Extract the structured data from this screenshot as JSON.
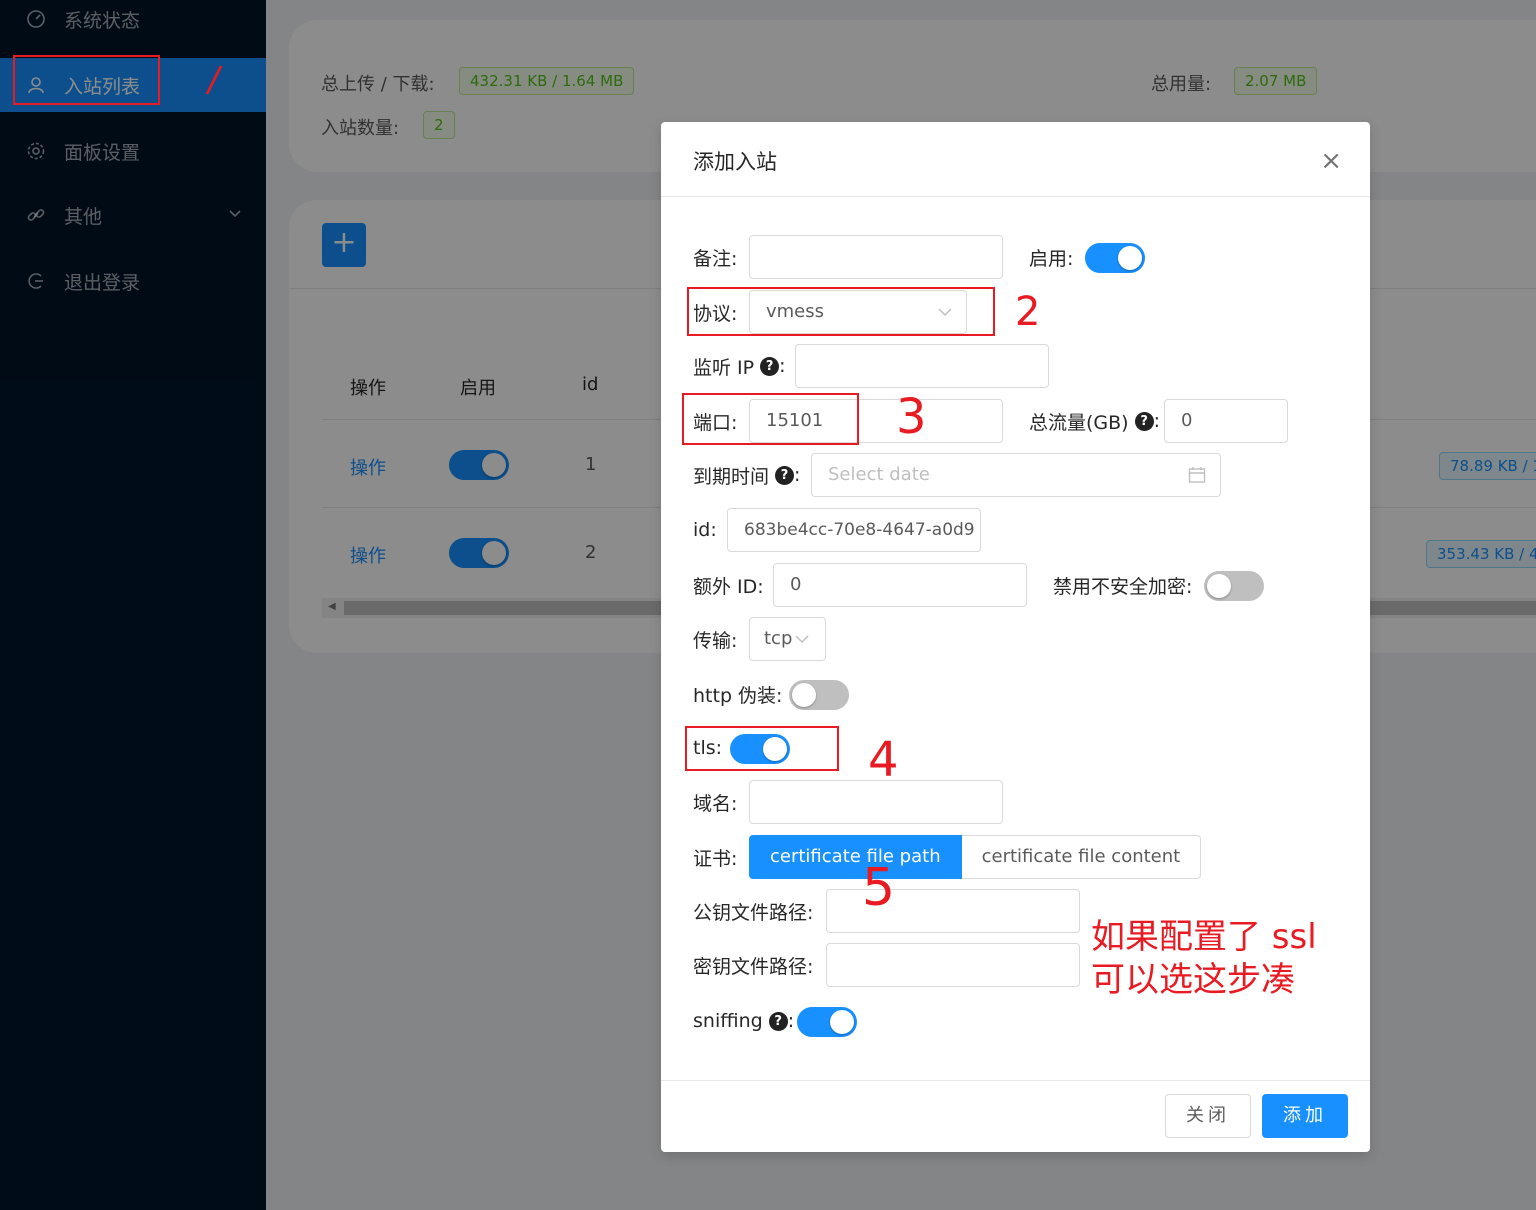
{
  "sidebar": {
    "items": [
      {
        "label": "系统状态"
      },
      {
        "label": "入站列表"
      },
      {
        "label": "面板设置"
      },
      {
        "label": "其他"
      },
      {
        "label": "退出登录"
      }
    ]
  },
  "stats": {
    "upload_download_label": "总上传 / 下载:",
    "upload_download_value": "432.31 KB / 1.64 MB",
    "total_usage_label": "总用量:",
    "total_usage_value": "2.07 MB",
    "inbound_count_label": "入站数量:",
    "inbound_count_value": "2"
  },
  "table": {
    "add_label": "+",
    "headers": [
      "操作",
      "启用",
      "id"
    ],
    "rows": [
      {
        "action": "操作",
        "id": "1",
        "traffic": "78.89 KB / 1"
      },
      {
        "action": "操作",
        "id": "2",
        "traffic": "353.43 KB / 4"
      }
    ]
  },
  "modal": {
    "title": "添加入站",
    "close_icon": "×",
    "remark_label": "备注:",
    "remark_value": "",
    "enable_label": "启用:",
    "protocol_label": "协议:",
    "protocol_value": "vmess",
    "listen_ip_label": "监听 IP",
    "listen_ip_value": "",
    "port_label": "端口:",
    "port_value": "15101",
    "total_traffic_label": "总流量(GB)",
    "total_traffic_value": "0",
    "expiry_label": "到期时间",
    "expiry_placeholder": "Select date",
    "id_label": "id:",
    "id_value": "683be4cc-70e8-4647-a0d9",
    "alter_id_label": "额外 ID:",
    "alter_id_value": "0",
    "disable_insecure_label": "禁用不安全加密:",
    "transport_label": "传输:",
    "transport_value": "tcp",
    "http_disguise_label": "http 伪装:",
    "tls_label": "tls:",
    "domain_label": "域名:",
    "domain_value": "",
    "cert_label": "证书:",
    "cert_options": [
      "certificate file path",
      "certificate file content"
    ],
    "public_key_label": "公钥文件路径:",
    "private_key_label": "密钥文件路径:",
    "sniffing_label": "sniffing",
    "close_button": "关闭",
    "add_button": "添加"
  },
  "annotations": {
    "n1": "/",
    "n2": "2",
    "n3": "3",
    "n4": "4",
    "n5": "5",
    "note_line1": "如果配置了 ssl",
    "note_line2": "可以选这步凑"
  },
  "colors": {
    "sidebar_bg": "#001529",
    "primary": "#1890ff",
    "annotation": "#e81b23"
  }
}
